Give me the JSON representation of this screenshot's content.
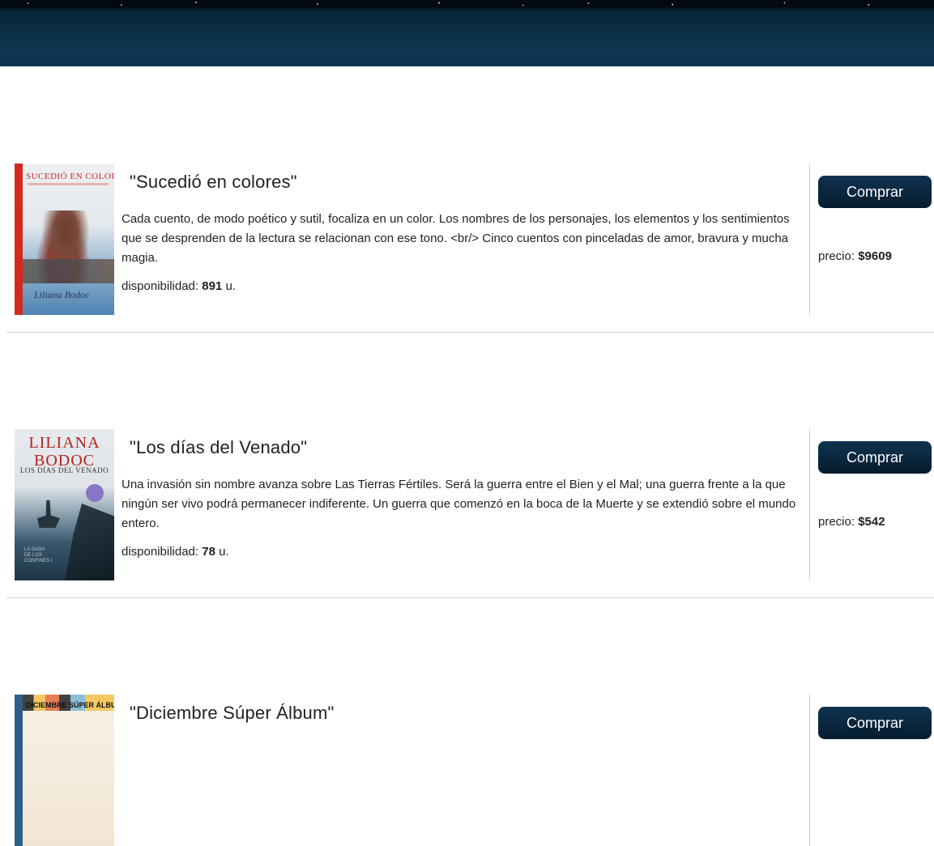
{
  "header": {
    "menu_icon": "chevron-icon"
  },
  "products": [
    {
      "title": "\"Sucedió en colores\"",
      "description": "Cada cuento, de modo poético y sutil, focaliza en un color. Los nombres de los personajes, los elementos y los sentimientos que se desprenden de la lectura se relacionan con ese tono. <br/> Cinco cuentos con pinceladas de amor, bravura y mucha magia.",
      "stock_label": "disponibilidad: ",
      "stock_value": "891",
      "stock_unit": " u.",
      "buy_label": "Comprar",
      "price_label": "precio: ",
      "price_value": "$9609",
      "cover": {
        "title": "SUCEDIÓ EN COLORES",
        "author_signature": "Liliana Bodoc",
        "accent_color": "#d42a1e"
      }
    },
    {
      "title": "\"Los días del Venado\"",
      "description": "Una invasión sin nombre avanza sobre Las Tierras Fértiles. Será la guerra entre el Bien y el Mal; una guerra frente a la que ningún ser vivo podrá permanecer indiferente. Un guerra que comenzó en la boca de la Muerte y se extendió sobre el mundo entero.",
      "stock_label": "disponibilidad: ",
      "stock_value": "78",
      "stock_unit": " u.",
      "buy_label": "Comprar",
      "price_label": "precio: ",
      "price_value": "$542",
      "cover": {
        "author_line1": "LILIANA",
        "author_line2": "BODOC",
        "title": "LOS DÍAS DEL VENADO",
        "accent_color": "#b1251c"
      }
    },
    {
      "title": "\"Diciembre Súper Álbum\"",
      "buy_label": "Comprar",
      "cover": {
        "title": "DICIEMBRE SÚPER ÁLBUM",
        "accent_color": "#2d5f8a"
      }
    }
  ],
  "colors": {
    "header_bg": "#0c3550",
    "button_bg": "#061c2e",
    "button_text": "#ffffff",
    "divider": "#d3d3d3"
  }
}
